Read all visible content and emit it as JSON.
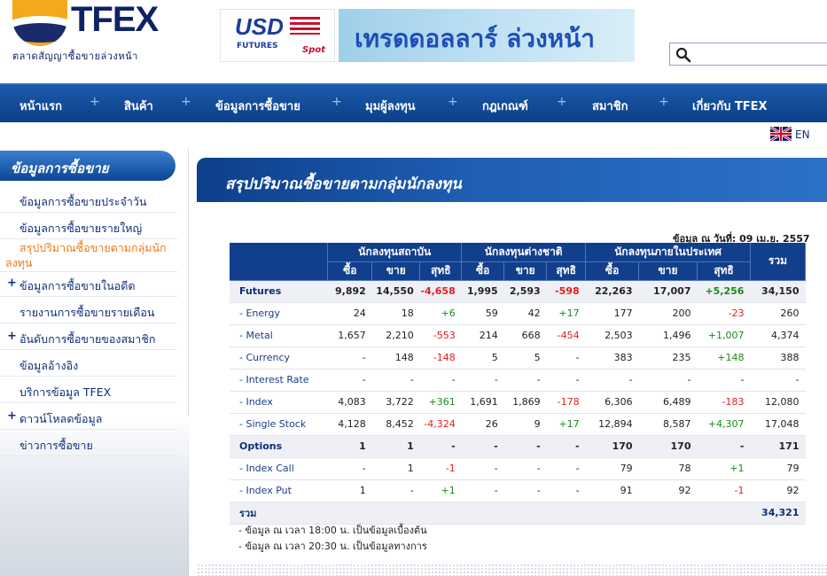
{
  "header": {
    "logo_text": "TFEX",
    "logo_subtitle": "ตลาดสัญญาซื้อขายล่วงหน้า",
    "banner": {
      "usd_label": "USD",
      "usd_futures": "FUTURES",
      "usd_spot": "Spot",
      "main_text": "เทรดดอลลาร์ ล่วงหน้า"
    },
    "search": {
      "placeholder": "",
      "value": ""
    }
  },
  "nav": {
    "items": [
      "หน้าแรก",
      "สินค้า",
      "ข้อมูลการซื้อขาย",
      "มุมผู้ลงทุน",
      "กฎเกณฑ์",
      "สมาชิก",
      "เกี่ยวกับ TFEX"
    ],
    "separator": "+"
  },
  "lang": {
    "label": "EN"
  },
  "sidebar": {
    "title": "ข้อมูลการซื้อขาย",
    "items": [
      {
        "label": "ข้อมูลการซื้อขายประจำวัน",
        "plus": ""
      },
      {
        "label": "ข้อมูลการซื้อขายรายใหญ่",
        "plus": ""
      },
      {
        "label": "สรุปปริมาณซื้อขายตามกลุ่มนักลงทุน",
        "plus": ""
      },
      {
        "label": "ข้อมูลการซื้อขายในอดีต",
        "plus": "+"
      },
      {
        "label": "รายงานการซื้อขายรายเดือน",
        "plus": ""
      },
      {
        "label": "อันดับการซื้อขายของสมาชิก",
        "plus": "+"
      },
      {
        "label": "ข้อมูลอ้างอิง",
        "plus": ""
      },
      {
        "label": "บริการข้อมูล TFEX",
        "plus": ""
      },
      {
        "label": "ดาวน์โหลดข้อมูล",
        "plus": "+"
      },
      {
        "label": "ข่าวการซื้อขาย",
        "plus": ""
      }
    ]
  },
  "main": {
    "title": "สรุปปริมาณซื้อขายตามกลุ่มนักลงทุน",
    "date_line": "ข้อมูล ณ วันที่: 09 เม.ย. 2557",
    "table": {
      "groups": [
        "นักลงทุนสถาบัน",
        "นักลงทุนต่างชาติ",
        "นักลงทุนภายในประเทศ"
      ],
      "total_header": "รวม",
      "sub_headers": [
        "ซื้อ",
        "ขาย",
        "สุทธิ"
      ],
      "rows": [
        {
          "name": "Futures",
          "type": "group",
          "values": [
            "9,892",
            "14,550",
            "-4,658",
            "1,995",
            "2,593",
            "-598",
            "22,263",
            "17,007",
            "+5,256",
            "34,150"
          ]
        },
        {
          "name": "- Energy",
          "type": "item",
          "values": [
            "24",
            "18",
            "+6",
            "59",
            "42",
            "+17",
            "177",
            "200",
            "-23",
            "260"
          ]
        },
        {
          "name": "- Metal",
          "type": "item",
          "values": [
            "1,657",
            "2,210",
            "-553",
            "214",
            "668",
            "-454",
            "2,503",
            "1,496",
            "+1,007",
            "4,374"
          ]
        },
        {
          "name": "- Currency",
          "type": "item",
          "values": [
            "-",
            "148",
            "-148",
            "5",
            "5",
            "-",
            "383",
            "235",
            "+148",
            "388"
          ]
        },
        {
          "name": "- Interest Rate",
          "type": "item",
          "values": [
            "-",
            "-",
            "-",
            "-",
            "-",
            "-",
            "-",
            "-",
            "-",
            "-"
          ]
        },
        {
          "name": "- Index",
          "type": "item",
          "values": [
            "4,083",
            "3,722",
            "+361",
            "1,691",
            "1,869",
            "-178",
            "6,306",
            "6,489",
            "-183",
            "12,080"
          ]
        },
        {
          "name": "- Single Stock",
          "type": "item",
          "values": [
            "4,128",
            "8,452",
            "-4,324",
            "26",
            "9",
            "+17",
            "12,894",
            "8,587",
            "+4,307",
            "17,048"
          ]
        },
        {
          "name": "Options",
          "type": "group",
          "values": [
            "1",
            "1",
            "-",
            "-",
            "-",
            "-",
            "170",
            "170",
            "-",
            "171"
          ]
        },
        {
          "name": "- Index Call",
          "type": "item",
          "values": [
            "-",
            "1",
            "-1",
            "-",
            "-",
            "-",
            "79",
            "78",
            "+1",
            "79"
          ]
        },
        {
          "name": "- Index Put",
          "type": "item",
          "values": [
            "1",
            "-",
            "+1",
            "-",
            "-",
            "-",
            "91",
            "92",
            "-1",
            "92"
          ]
        }
      ],
      "total_row": {
        "label": "รวม",
        "value": "34,321"
      }
    },
    "notes": [
      "- ข้อมูล ณ เวลา 18:00 น. เป็นข้อมูลเบื้องต้น",
      "- ข้อมูล ณ เวลา 20:30 น. เป็นข้อมูลทางการ"
    ]
  },
  "colors": {
    "nav_bg": "#0c3f8a",
    "positive": "#1a8a1a",
    "negative": "#e0201c",
    "active_link": "#f07a18"
  }
}
